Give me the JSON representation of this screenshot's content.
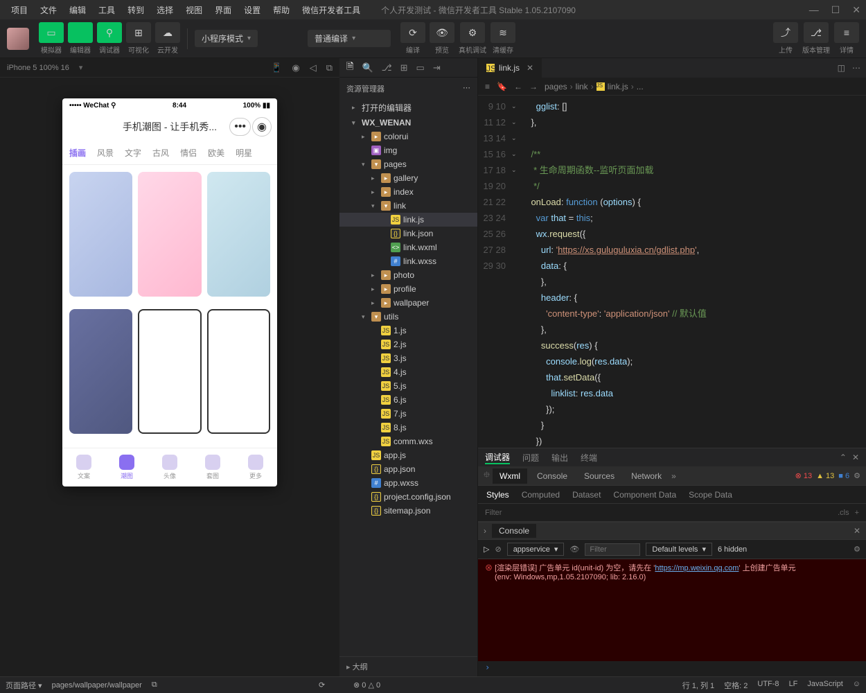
{
  "menubar": {
    "items": [
      "项目",
      "文件",
      "编辑",
      "工具",
      "转到",
      "选择",
      "视图",
      "界面",
      "设置",
      "帮助",
      "微信开发者工具"
    ],
    "title": "个人开发测试 - 微信开发者工具 Stable 1.05.2107090"
  },
  "toolbar": {
    "groups": [
      {
        "icon": "▭",
        "label": "模拟器",
        "green": true
      },
      {
        "icon": "</>",
        "label": "编辑器",
        "green": true
      },
      {
        "icon": "⚲",
        "label": "调试器",
        "green": true
      },
      {
        "icon": "⊞",
        "label": "可视化"
      },
      {
        "icon": "☁",
        "label": "云开发"
      }
    ],
    "mode": "小程序模式",
    "compile": "普通编译",
    "actions": [
      {
        "icon": "⟳",
        "label": "编译"
      },
      {
        "icon": "👁",
        "label": "预览"
      },
      {
        "icon": "⚙",
        "label": "真机调试"
      },
      {
        "icon": "≋",
        "label": "清缓存"
      }
    ],
    "right": [
      {
        "icon": "⤴",
        "label": "上传"
      },
      {
        "icon": "⎇",
        "label": "版本管理"
      },
      {
        "icon": "≡",
        "label": "详情"
      }
    ]
  },
  "simHeader": {
    "device": "iPhone 5 100% 16"
  },
  "phone": {
    "time": "8:44",
    "battery": "100%",
    "carrier": "••••• WeChat ⚲",
    "title": "手机潮图 - 让手机秀...",
    "tabs": [
      "插画",
      "风景",
      "文字",
      "古风",
      "情侣",
      "欧美",
      "明星"
    ],
    "bottom": [
      {
        "label": "文案"
      },
      {
        "label": "潮图",
        "active": true
      },
      {
        "label": "头像"
      },
      {
        "label": "套图"
      },
      {
        "label": "更多"
      }
    ]
  },
  "explorer": {
    "title": "资源管理器",
    "sections": [
      "打开的编辑器",
      "WX_WENAN"
    ],
    "tree": [
      {
        "name": "colorui",
        "type": "folder",
        "pad": 2
      },
      {
        "name": "img",
        "type": "img",
        "pad": 2
      },
      {
        "name": "pages",
        "type": "folder-open",
        "pad": 2,
        "open": true
      },
      {
        "name": "gallery",
        "type": "folder",
        "pad": 3
      },
      {
        "name": "index",
        "type": "folder",
        "pad": 3
      },
      {
        "name": "link",
        "type": "folder-open",
        "pad": 3,
        "open": true
      },
      {
        "name": "link.js",
        "type": "js",
        "pad": 4,
        "selected": true
      },
      {
        "name": "link.json",
        "type": "json",
        "pad": 4
      },
      {
        "name": "link.wxml",
        "type": "wxml",
        "pad": 4
      },
      {
        "name": "link.wxss",
        "type": "wxss",
        "pad": 4
      },
      {
        "name": "photo",
        "type": "folder",
        "pad": 3
      },
      {
        "name": "profile",
        "type": "folder",
        "pad": 3
      },
      {
        "name": "wallpaper",
        "type": "folder",
        "pad": 3
      },
      {
        "name": "utils",
        "type": "folder-open",
        "pad": 2,
        "open": true
      },
      {
        "name": "1.js",
        "type": "js",
        "pad": 3
      },
      {
        "name": "2.js",
        "type": "js",
        "pad": 3
      },
      {
        "name": "3.js",
        "type": "js",
        "pad": 3
      },
      {
        "name": "4.js",
        "type": "js",
        "pad": 3
      },
      {
        "name": "5.js",
        "type": "js",
        "pad": 3
      },
      {
        "name": "6.js",
        "type": "js",
        "pad": 3
      },
      {
        "name": "7.js",
        "type": "js",
        "pad": 3
      },
      {
        "name": "8.js",
        "type": "js",
        "pad": 3
      },
      {
        "name": "comm.wxs",
        "type": "js",
        "pad": 3
      },
      {
        "name": "app.js",
        "type": "js",
        "pad": 2
      },
      {
        "name": "app.json",
        "type": "json",
        "pad": 2
      },
      {
        "name": "app.wxss",
        "type": "wxss",
        "pad": 2
      },
      {
        "name": "project.config.json",
        "type": "json",
        "pad": 2
      },
      {
        "name": "sitemap.json",
        "type": "json",
        "pad": 2
      }
    ],
    "outline": "大纲"
  },
  "editor": {
    "tab": "link.js",
    "breadcrumb": [
      "pages",
      "link",
      "link.js",
      "..."
    ],
    "startLine": 9,
    "code": "      gglist: []\n    },\n\n    /**\n     * 生命周期函数--监听页面加载\n     */\n    onLoad: function (options) {\n      var that = this;\n      wx.request({\n        url: 'https://xs.guluguluxia.cn/gdlist.php',\n        data: {\n        },\n        header: {\n          'content-type': 'application/json' // 默认值\n        },\n        success(res) {\n          console.log(res.data);\n          that.setData({\n            linklist: res.data\n          });\n        }\n      })"
  },
  "debugger": {
    "tabs": [
      "调试器",
      "问题",
      "输出",
      "终端"
    ],
    "devtabs": [
      "Wxml",
      "Console",
      "Sources",
      "Network"
    ],
    "badges": {
      "err": "13",
      "warn": "13",
      "info": "6"
    },
    "styleTabs": [
      "Styles",
      "Computed",
      "Dataset",
      "Component Data",
      "Scope Data"
    ],
    "filter": "Filter",
    "cls": ".cls",
    "consoleTitle": "Console",
    "context": "appservice",
    "levels": "Default levels",
    "hidden": "6 hidden",
    "error": {
      "l1": "[渲染层错误] 广告单元 id(unit-id) 为空，请先在 '",
      "link": "https://mp.weixin.qq.com",
      "l1b": "' 上创建广告单元",
      "l2": "(env: Windows,mp,1.05.2107090; lib: 2.16.0)"
    }
  },
  "statusbar": {
    "pathLabel": "页面路径",
    "path": "pages/wallpaper/wallpaper",
    "errors": "⊗ 0 △ 0",
    "line": "行 1, 列 1",
    "spaces": "空格: 2",
    "enc": "UTF-8",
    "eol": "LF",
    "lang": "JavaScript"
  }
}
